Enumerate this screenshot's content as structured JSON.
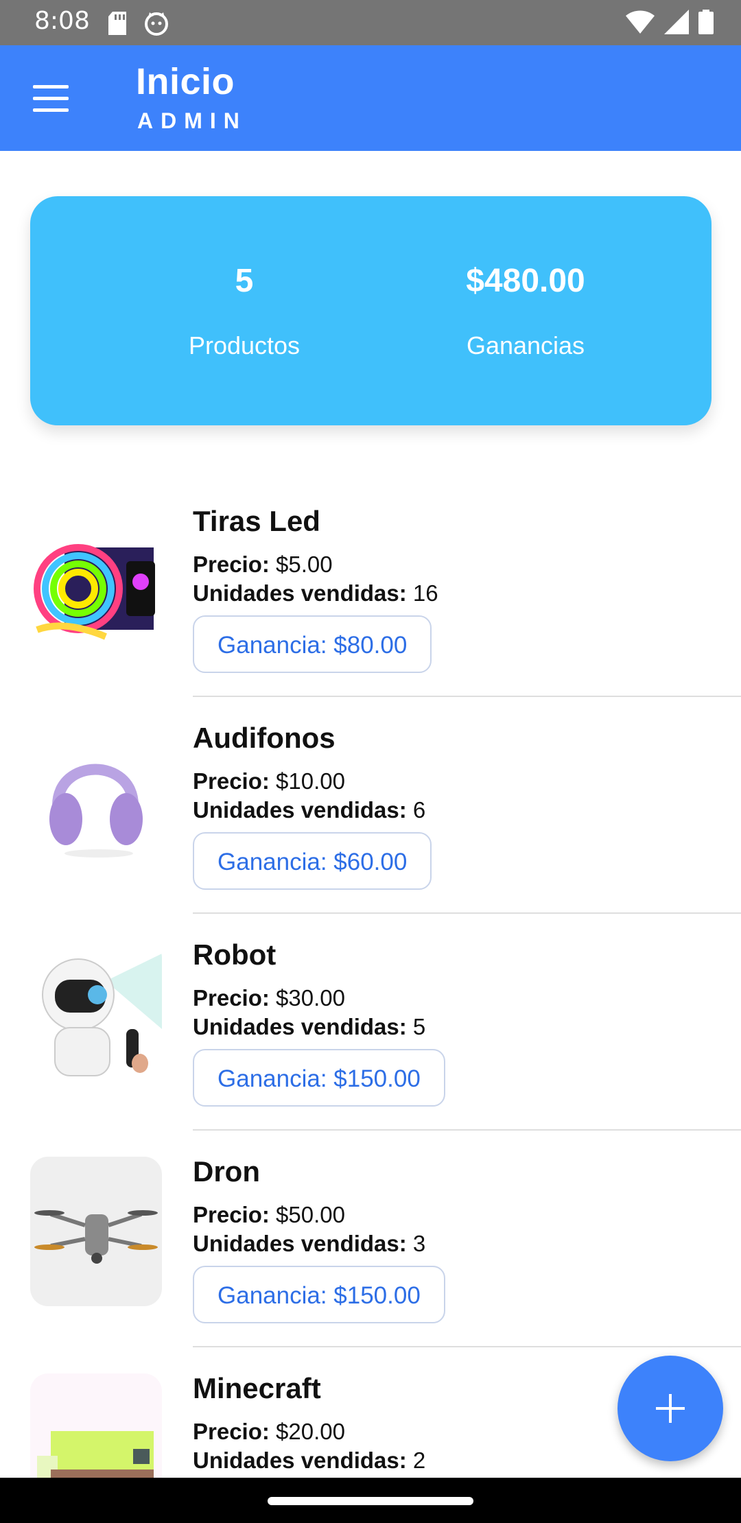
{
  "status_bar": {
    "time": "8:08"
  },
  "app_bar": {
    "title": "Inicio",
    "subtitle": "ADMIN"
  },
  "summary": {
    "products_count": "5",
    "products_label": "Productos",
    "earnings_value": "$480.00",
    "earnings_label": "Ganancias"
  },
  "labels": {
    "price": "Precio:",
    "units_sold": "Unidades vendidas:"
  },
  "products": [
    {
      "name": "Tiras Led",
      "price": "$5.00",
      "units": "16",
      "gain": "Ganancia: $80.00"
    },
    {
      "name": "Audifonos",
      "price": "$10.00",
      "units": "6",
      "gain": "Ganancia: $60.00"
    },
    {
      "name": "Robot",
      "price": "$30.00",
      "units": "5",
      "gain": "Ganancia: $150.00"
    },
    {
      "name": "Dron",
      "price": "$50.00",
      "units": "3",
      "gain": "Ganancia: $150.00"
    },
    {
      "name": "Minecraft",
      "price": "$20.00",
      "units": "2"
    }
  ],
  "colors": {
    "app_bar": "#3d82fb",
    "summary_card": "#40c0fb",
    "gain_text": "#2d6ee6",
    "fab": "#3d82fb"
  },
  "icons": {
    "menu": "hamburger-menu-icon",
    "fab": "plus-icon"
  }
}
